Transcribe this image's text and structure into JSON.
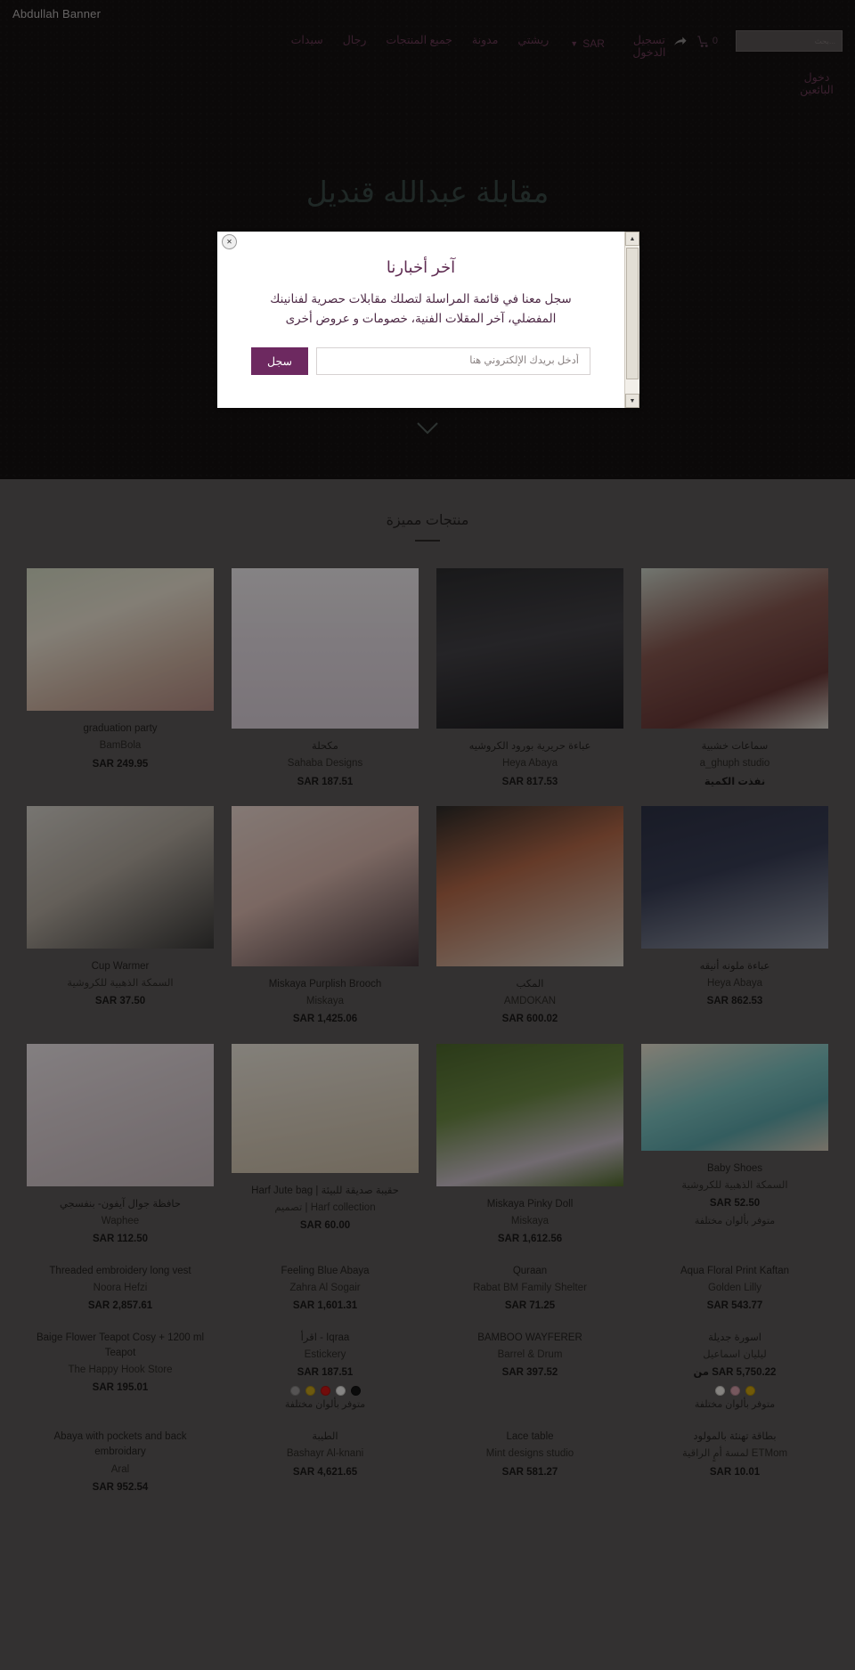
{
  "brand": {
    "title": "Abdullah Banner"
  },
  "header": {
    "share_icon": "share-icon",
    "cart_icon": "cart-icon",
    "cart_count": "0",
    "search_placeholder": "بحث...",
    "currency": "SAR",
    "currency_chevron": "chevron-down-icon",
    "login": "تسجيل الدخول",
    "nav": [
      {
        "label": "سيدات"
      },
      {
        "label": "رجال"
      },
      {
        "label": "جميع المنتجات"
      },
      {
        "label": "مدونة"
      },
      {
        "label": "ريشتي"
      }
    ],
    "nav_secondary": {
      "label": "دخول البائعين"
    }
  },
  "hero": {
    "title": "مقابلة عبدالله قنديل",
    "scroll_icon": "chevron-down-icon"
  },
  "modal": {
    "title": "آخر أخبارنا",
    "subtitle": "سجل معنا في قائمة المراسلة لتصلك مقابلات حصرية لفنانينك المفضلي، آخر المقلات الفنية، خصومات و عروض أخرى",
    "email_placeholder": "أدخل بريدك الإلكتروني هنا",
    "email_value": "",
    "submit_label": "سجل",
    "close_label": "✕",
    "scroll_up": "▲",
    "scroll_down": "▼"
  },
  "products_section": {
    "title": "منتجات مميزة",
    "items": [
      {
        "name": "graduation party",
        "vendor": "BamBola",
        "price": "SAR 249.95",
        "note": "",
        "img": "ph1",
        "img_h": "h160",
        "swatches": []
      },
      {
        "name": "مكحلة",
        "vendor": "Sahaba Designs",
        "price": "SAR 187.51",
        "note": "",
        "img": "ph2",
        "img_h": "h180",
        "swatches": []
      },
      {
        "name": "عباءة حريرية بورود الكروشيه",
        "vendor": "Heya Abaya",
        "price": "SAR 817.53",
        "note": "",
        "img": "ph3",
        "img_h": "h180",
        "swatches": []
      },
      {
        "name": "سماعات خشبية",
        "vendor": "a_ghuph studio",
        "price": "نفذت الكمية",
        "note": "",
        "img": "ph4",
        "img_h": "h180",
        "swatches": []
      },
      {
        "name": "Cup Warmer",
        "vendor": "السمكة الذهبية للكروشية",
        "price": "SAR 37.50",
        "note": "",
        "img": "ph5",
        "img_h": "h160",
        "swatches": []
      },
      {
        "name": "Miskaya Purplish Brooch",
        "vendor": "Miskaya",
        "price": "SAR 1,425.06",
        "note": "",
        "img": "ph6",
        "img_h": "h180",
        "swatches": []
      },
      {
        "name": "المكب",
        "vendor": "AMDOKAN",
        "price": "SAR 600.02",
        "note": "",
        "img": "ph7",
        "img_h": "h180",
        "swatches": []
      },
      {
        "name": "عباءة ملونه أنيقه",
        "vendor": "Heya Abaya",
        "price": "SAR 862.53",
        "note": "",
        "img": "ph8",
        "img_h": "h160",
        "swatches": []
      },
      {
        "name": "حافظة جوال آيفون- بنفسجي",
        "vendor": "Waphee",
        "price": "SAR 112.50",
        "note": "",
        "img": "ph9",
        "img_h": "h160",
        "swatches": []
      },
      {
        "name": "Harf Jute bag | حقيبة صديقة للبيئة",
        "vendor": "تصميم | Harf collection",
        "price": "SAR 60.00",
        "note": "",
        "img": "ph10",
        "img_h": "h145",
        "swatches": []
      },
      {
        "name": "Miskaya Pinky Doll",
        "vendor": "Miskaya",
        "price": "SAR 1,612.56",
        "note": "",
        "img": "ph11",
        "img_h": "h160",
        "swatches": []
      },
      {
        "name": "Baby Shoes",
        "vendor": "السمكة الذهبية للكروشية",
        "price": "SAR 52.50",
        "note": "متوفر بألوان مختلفة",
        "img": "ph12",
        "img_h": "h120",
        "swatches": []
      },
      {
        "name": "Threaded embroidery long vest",
        "vendor": "Noora Hefzi",
        "price": "SAR 2,857.61",
        "note": "",
        "img": "",
        "img_h": "h0",
        "swatches": []
      },
      {
        "name": "Feeling Blue Abaya",
        "vendor": "Zahra Al Sogair",
        "price": "SAR 1,601.31",
        "note": "",
        "img": "",
        "img_h": "h0",
        "swatches": []
      },
      {
        "name": "Quraan",
        "vendor": "Rabat BM Family Shelter",
        "price": "SAR 71.25",
        "note": "",
        "img": "",
        "img_h": "h0",
        "swatches": []
      },
      {
        "name": "Aqua Floral Print Kaftan",
        "vendor": "Golden Lilly",
        "price": "SAR 543.77",
        "note": "",
        "img": "",
        "img_h": "h0",
        "swatches": []
      },
      {
        "name": "Baige Flower Teapot Cosy + 1200 ml Teapot",
        "vendor": "The Happy Hook Store",
        "price": "SAR 195.01",
        "note": "",
        "img": "",
        "img_h": "h0",
        "swatches": []
      },
      {
        "name": "اقرأ - Iqraa",
        "vendor": "Estickery",
        "price": "SAR 187.51",
        "note": "متوفر بألوان مختلفة",
        "img": "",
        "img_h": "h0",
        "swatches": [
          "#9b9897",
          "#c9a41c",
          "#cf1614",
          "#f5f3f0",
          "#141414"
        ]
      },
      {
        "name": "BAMBOO WAYFERER",
        "vendor": "Barrel & Drum",
        "price": "SAR 397.52",
        "note": "",
        "img": "",
        "img_h": "h0",
        "swatches": []
      },
      {
        "name": "اسورة جديلة",
        "vendor": "ليليان اسماعيل",
        "price": "من SAR 5,750.22",
        "note": "متوفر بألوان مختلفة",
        "img": "",
        "img_h": "h0",
        "swatches": [
          "#f3efe9",
          "#d7a0ab",
          "#cfa50f"
        ]
      },
      {
        "name": "Abaya with pockets and back embroidary",
        "vendor": "Aral",
        "price": "SAR 952.54",
        "note": "",
        "img": "",
        "img_h": "h0",
        "swatches": []
      },
      {
        "name": "الطيبة",
        "vendor": "Bashayr Al-knani",
        "price": "SAR 4,621.65",
        "note": "",
        "img": "",
        "img_h": "h0",
        "swatches": []
      },
      {
        "name": "Lace table",
        "vendor": "Mint designs studio",
        "price": "SAR 581.27",
        "note": "",
        "img": "",
        "img_h": "h0",
        "swatches": []
      },
      {
        "name": "بطاقة تهنئة بالمولود",
        "vendor": "لمسة أمٍ الراقية ETMom",
        "price": "SAR 10.01",
        "note": "",
        "img": "",
        "img_h": "h0",
        "swatches": []
      }
    ]
  },
  "colors": {
    "accent": "#6d2960",
    "nav_link": "#6a3a55",
    "hero_title": "#3a4a46",
    "products_bg": "#5d5a59"
  }
}
